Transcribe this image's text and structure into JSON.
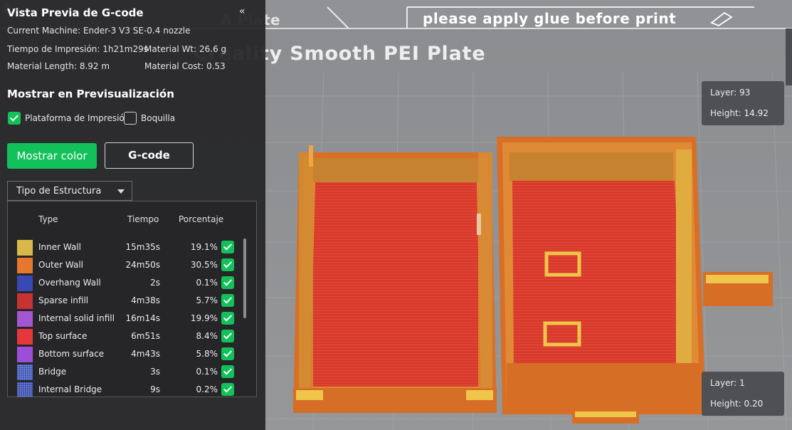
{
  "viewport": {
    "plate_name": "A Plate",
    "plate_note": "please apply glue before print",
    "plate_title": "Creality Smooth PEI Plate",
    "layer_top": {
      "layer_label": "Layer:",
      "layer_value": "93",
      "height_label": "Height:",
      "height_value": "14.92"
    },
    "layer_bottom": {
      "layer_label": "Layer:",
      "layer_value": "1",
      "height_label": "Height:",
      "height_value": "0.20"
    },
    "collapse_icon": "double-chevron-left-icon",
    "home_icon": "home-icon"
  },
  "panel": {
    "title": "Vista Previa de G-code",
    "machine": "Current Machine: Ender-3 V3 SE-0.4 nozzle",
    "print_time": "Tiempo de Impresión: 1h21m29s",
    "material_wt": "Material Wt: 26.6 g",
    "material_length": "Material Length: 8.92 m",
    "material_cost": "Material Cost: 0.53",
    "section_title": "Mostrar en Previsualización",
    "checkbox_plate": {
      "label": "Plataforma de Impresión",
      "checked": true
    },
    "checkbox_nozzle": {
      "label": "Boquilla",
      "checked": false
    },
    "btn_color": "Mostrar color",
    "btn_gcode": "G-code",
    "select_value": "Tipo de Estructura",
    "legend_headers": {
      "type": "Type",
      "time": "Tiempo",
      "percent": "Porcentaje"
    },
    "legend_rows": [
      {
        "type": "Inner Wall",
        "time": "15m35s",
        "percent": "19.1%",
        "color": "#d9b84a",
        "checked": true
      },
      {
        "type": "Outer Wall",
        "time": "24m50s",
        "percent": "30.5%",
        "color": "#e5782d",
        "checked": true
      },
      {
        "type": "Overhang Wall",
        "time": "2s",
        "percent": "0.1%",
        "color": "#3848b4",
        "checked": true
      },
      {
        "type": "Sparse infill",
        "time": "4m38s",
        "percent": "5.7%",
        "color": "#c93232",
        "checked": true
      },
      {
        "type": "Internal solid infill",
        "time": "16m14s",
        "percent": "19.9%",
        "color": "#a356d1",
        "checked": true
      },
      {
        "type": "Top surface",
        "time": "6m51s",
        "percent": "8.4%",
        "color": "#e6373d",
        "checked": true
      },
      {
        "type": "Bottom surface",
        "time": "4m43s",
        "percent": "5.8%",
        "color": "#9c4fd6",
        "checked": true
      },
      {
        "type": "Bridge",
        "time": "3s",
        "percent": "0.1%",
        "color": "#3e58b8",
        "checked": true
      },
      {
        "type": "Internal Bridge",
        "time": "9s",
        "percent": "0.2%",
        "color": "#3a4fb0",
        "checked": true
      }
    ]
  }
}
